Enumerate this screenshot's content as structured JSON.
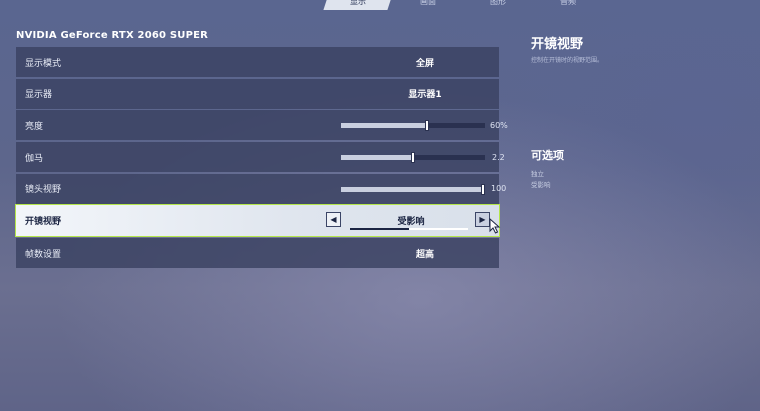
{
  "tabs": [
    {
      "label": "显示",
      "active": true
    },
    {
      "label": "画面",
      "active": false
    },
    {
      "label": "图形",
      "active": false
    },
    {
      "label": "音频",
      "active": false
    }
  ],
  "gpu_title": "NVIDIA GeForce RTX 2060 SUPER",
  "settings": {
    "display_mode": {
      "label": "显示模式",
      "value": "全屏"
    },
    "monitor": {
      "label": "显示器",
      "value": "显示器1"
    },
    "brightness": {
      "label": "亮度",
      "value": "60%",
      "level": 0.6
    },
    "gamma": {
      "label": "伽马",
      "value": "2.2",
      "level": 0.5
    },
    "fov": {
      "label": "镜头视野",
      "value": "100",
      "level": 1.0
    },
    "scope_fov": {
      "label": "开镜视野",
      "value": "受影响"
    },
    "framerate": {
      "label": "帧数设置",
      "value": "超高"
    }
  },
  "detail": {
    "title": "开镜视野",
    "description": "控制在开镜时的视野范围。",
    "options_title": "可选项",
    "options": [
      "独立",
      "受影响"
    ]
  },
  "colors": {
    "accent": "#b4e64a",
    "row_bg": "#3a4262"
  }
}
